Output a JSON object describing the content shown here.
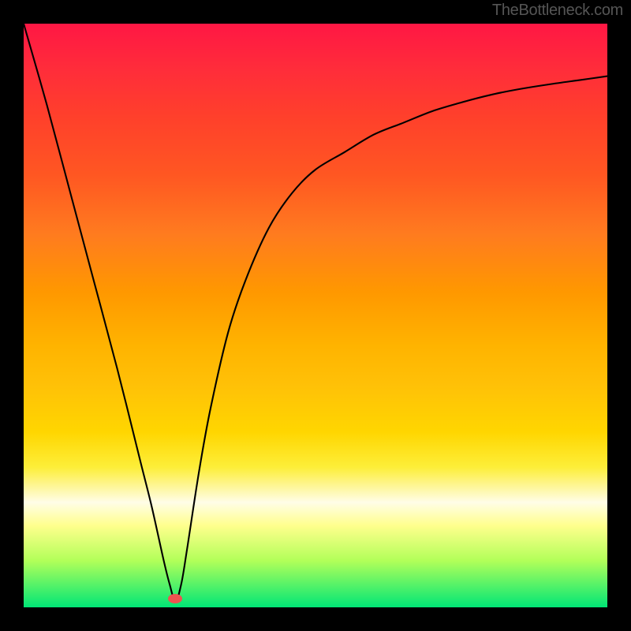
{
  "watermark": "TheBottleneck.com",
  "chart_data": {
    "type": "line",
    "title": "",
    "xlabel": "",
    "ylabel": "",
    "xlim": [
      0,
      100
    ],
    "ylim": [
      0,
      100
    ],
    "annotations": [],
    "marker": {
      "x": 26,
      "y": 1.5
    },
    "series": [
      {
        "name": "curve",
        "color": "#000000",
        "x": [
          0,
          4,
          8,
          12,
          16,
          20,
          22,
          24,
          25,
          26,
          27,
          28,
          30,
          32,
          35,
          38,
          42,
          46,
          50,
          55,
          60,
          65,
          70,
          75,
          80,
          85,
          90,
          95,
          100
        ],
        "y": [
          100,
          86,
          71,
          56,
          41,
          25,
          17,
          8,
          4,
          1,
          4,
          10,
          23,
          34,
          47,
          56,
          65,
          71,
          75,
          78,
          81,
          83,
          85,
          86.5,
          87.8,
          88.8,
          89.6,
          90.3,
          91
        ]
      }
    ],
    "background_gradient": {
      "top_color": "#ff1744",
      "mid_color": "#ffd600",
      "bottom_color": "#00e676"
    }
  }
}
